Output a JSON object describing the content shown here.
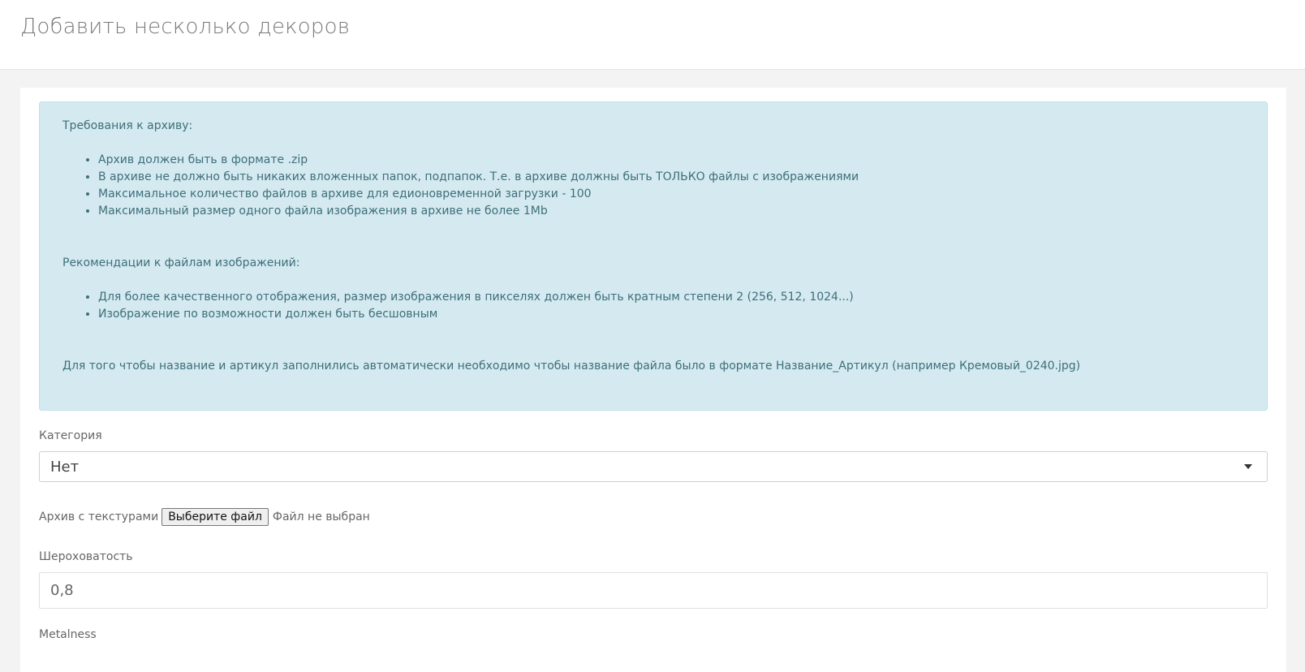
{
  "header": {
    "title": "Добавить несколько декоров"
  },
  "info": {
    "requirements_title": "Требования к архиву:",
    "requirements": [
      "Архив должен быть в формате .zip",
      "В архиве не должно быть никаких вложенных папок, подпапок. Т.е. в архиве должны быть ТОЛЬКО файлы с изображениями",
      "Максимальное количество файлов в архиве для едионовременной загрузки - 100",
      "Максимальный размер одного файла изображения в архиве не более 1Mb"
    ],
    "recommendations_title": "Рекомендации к файлам изображений:",
    "recommendations": [
      "Для более качественного отображения, размер изображения в пикселях должен быть кратным степени 2 (256, 512, 1024...)",
      "Изображение по возможности должен быть бесшовным"
    ],
    "note": "Для того чтобы название и артикул заполнились автоматически необходимо чтобы название файла было в формате Название_Артикул (например Кремовый_0240.jpg)"
  },
  "form": {
    "category_label": "Категория",
    "category_value": "Нет",
    "archive_label": "Архив с текстурами",
    "file_button": "Выберите файл",
    "file_status": "Файл не выбран",
    "roughness_label": "Шероховатость",
    "roughness_value": "0,8",
    "metalness_label": "Metalness"
  }
}
